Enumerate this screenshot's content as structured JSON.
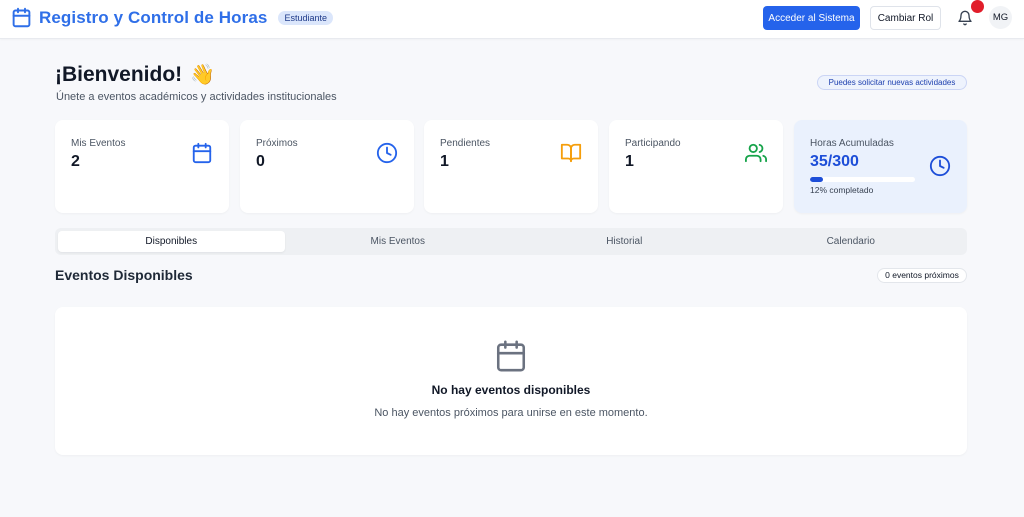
{
  "header": {
    "title": "Registro y Control de Horas",
    "role_badge": "Estudiante",
    "primary_button": "Acceder al Sistema",
    "secondary_button": "Cambiar Rol",
    "avatar_initials": "MG",
    "bell_icon": "bell-icon",
    "brand_icon": "calendar-icon",
    "brand_color": "#2f6fe8"
  },
  "welcome": {
    "title": "¡Bienvenido!",
    "emoji": "👋",
    "subtitle": "Únete a eventos académicos y actividades institucionales",
    "badge": "Puedes solicitar nuevas actividades"
  },
  "stats": [
    {
      "label": "Mis Eventos",
      "value": "2",
      "icon": "calendar-icon",
      "color": "#2563eb"
    },
    {
      "label": "Próximos",
      "value": "0",
      "icon": "clock-icon",
      "color": "#2563eb"
    },
    {
      "label": "Pendientes",
      "value": "1",
      "icon": "book-open-icon",
      "color": "#f59e0b"
    },
    {
      "label": "Participando",
      "value": "1",
      "icon": "users-icon",
      "color": "#16a34a"
    }
  ],
  "hours": {
    "label": "Horas Acumuladas",
    "value": "35/300",
    "progress": 0.12,
    "progress_text": "12% completado",
    "icon": "clock-icon",
    "color": "#1d4ed8"
  },
  "tabs": [
    {
      "label": "Disponibles",
      "active": true
    },
    {
      "label": "Mis Eventos",
      "active": false
    },
    {
      "label": "Historial",
      "active": false
    },
    {
      "label": "Calendario",
      "active": false
    }
  ],
  "section": {
    "title": "Eventos Disponibles",
    "count_badge": "0 eventos próximos"
  },
  "empty": {
    "icon": "calendar-icon",
    "title": "No hay eventos disponibles",
    "text": "No hay eventos próximos para unirse en este momento."
  }
}
